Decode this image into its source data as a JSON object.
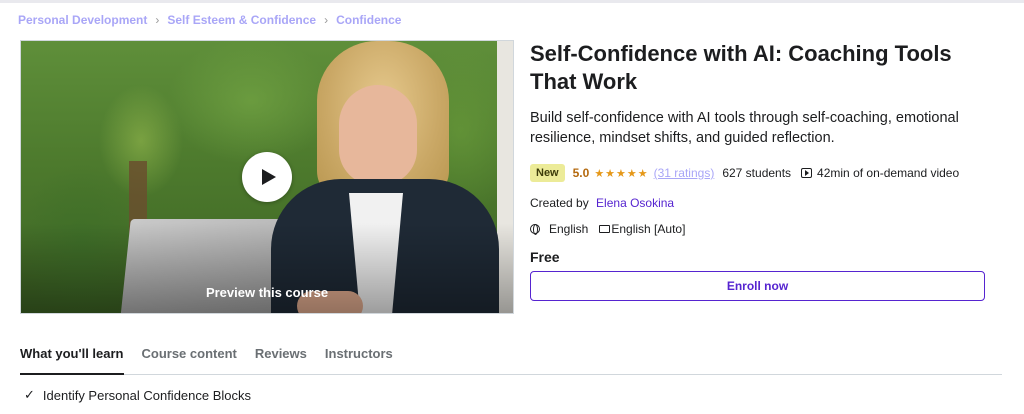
{
  "breadcrumb": [
    "Personal Development",
    "Self Esteem & Confidence",
    "Confidence"
  ],
  "preview": {
    "label": "Preview this course"
  },
  "course": {
    "title": "Self-Confidence with AI: Coaching Tools That Work",
    "description": "Build self-confidence with AI tools through self-coaching, emotional resilience, mindset shifts, and guided reflection.",
    "badge": "New",
    "rating": "5.0",
    "stars": "★★★★★",
    "ratings_count": "(31 ratings)",
    "students": "627 students",
    "video": "42min of on-demand video",
    "created_by_label": "Created by",
    "author": "Elena Osokina",
    "language": "English",
    "captions": "English [Auto]",
    "price": "Free",
    "enroll_label": "Enroll now"
  },
  "tabs": [
    "What you'll learn",
    "Course content",
    "Reviews",
    "Instructors"
  ],
  "learn_items": [
    "Identify Personal Confidence Blocks"
  ],
  "colors": {
    "accent": "#5624d0",
    "rating": "#b4690e",
    "star": "#e59819",
    "badge_bg": "#eceb98",
    "breadcrumb": "#a9a6f7"
  }
}
